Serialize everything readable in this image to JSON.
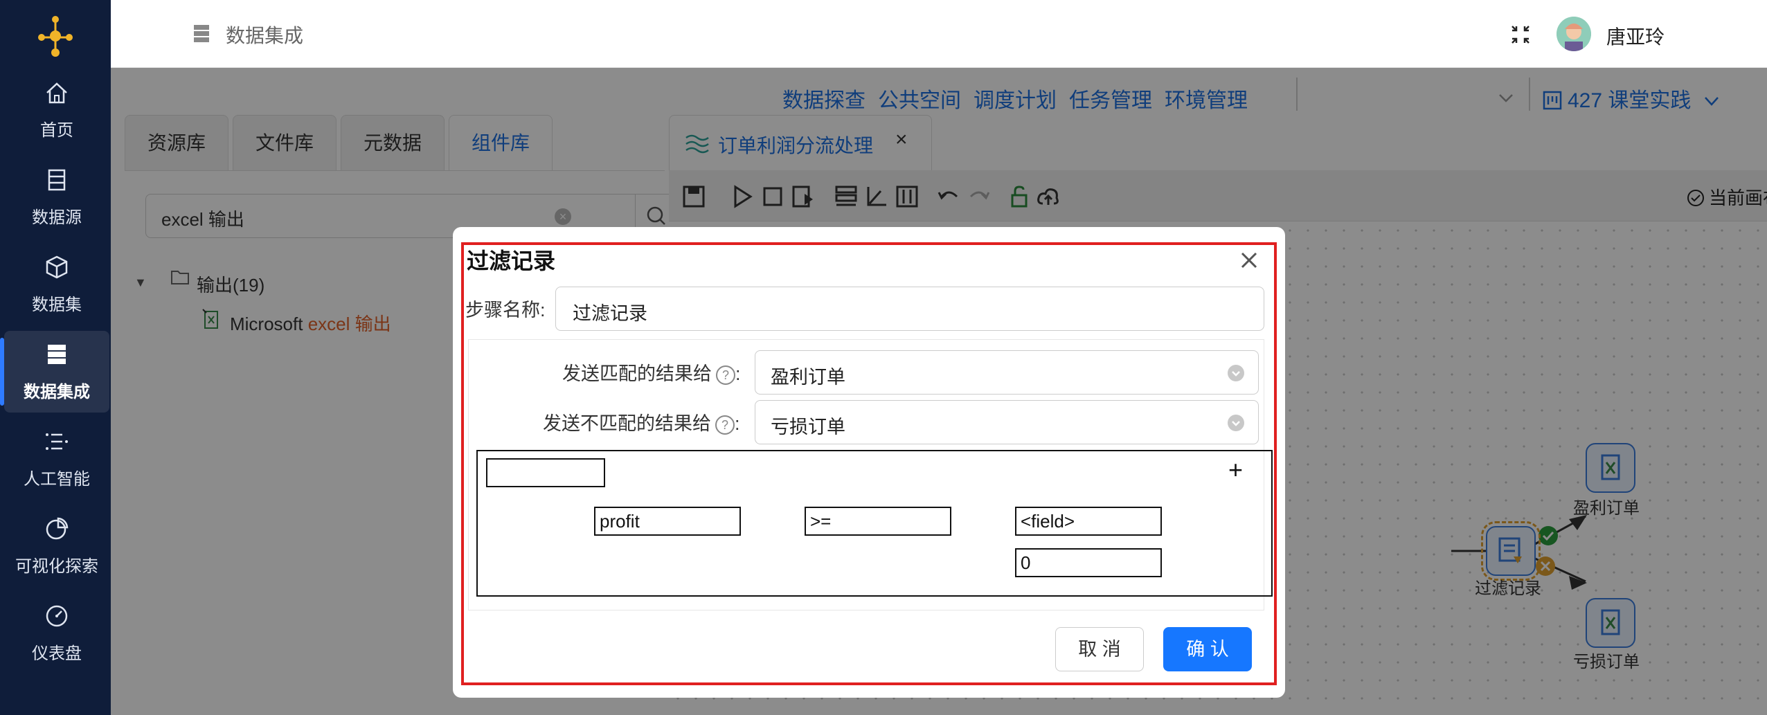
{
  "sidebar": {
    "items": [
      {
        "label": "首页",
        "icon": "home-icon"
      },
      {
        "label": "数据源",
        "icon": "datasource-icon"
      },
      {
        "label": "数据集",
        "icon": "cube-icon"
      },
      {
        "label": "数据集成",
        "icon": "database-icon",
        "active": true
      },
      {
        "label": "人工智能",
        "icon": "ai-icon"
      },
      {
        "label": "可视化探索",
        "icon": "pie-chart-icon"
      },
      {
        "label": "仪表盘",
        "icon": "dashboard-icon"
      }
    ]
  },
  "header": {
    "title": "数据集成",
    "user_name": "唐亚玲"
  },
  "topnav": {
    "links": [
      "数据探查",
      "公共空间",
      "调度计划",
      "任务管理",
      "环境管理"
    ],
    "project": "427 课堂实践"
  },
  "left_panel": {
    "tabs": [
      "资源库",
      "文件库",
      "元数据",
      "组件库"
    ],
    "active_tab": "组件库",
    "search_value": "excel 输出",
    "tree": {
      "folder_label": "输出(19)",
      "leaf_prefix": "Microsoft ",
      "leaf_highlight": "excel 输出"
    }
  },
  "canvas": {
    "tab_label": "订单利润分流处理",
    "saved_status": "当前画布已保存",
    "nodes": {
      "filter": "过滤记录",
      "profit": "盈利订单",
      "loss": "亏损订单"
    }
  },
  "dialog": {
    "title": "过滤记录",
    "step_name_label": "步骤名称:",
    "step_name_value": "过滤记录",
    "send_match_label": "发送匹配的结果给",
    "send_match_value": "盈利订单",
    "send_nomatch_label": "发送不匹配的结果给",
    "send_nomatch_value": "亏损订单",
    "colon": ":",
    "help_glyph": "?",
    "condition": {
      "field": "profit",
      "operator": ">=",
      "value_type": "<field>",
      "value": "0"
    },
    "cancel_label": "取 消",
    "ok_label": "确 认"
  },
  "colors": {
    "accent": "#1677ff",
    "sidebar_bg": "#0f1d3a",
    "highlight_frame": "#e02020",
    "search_highlight": "#e0622b"
  }
}
